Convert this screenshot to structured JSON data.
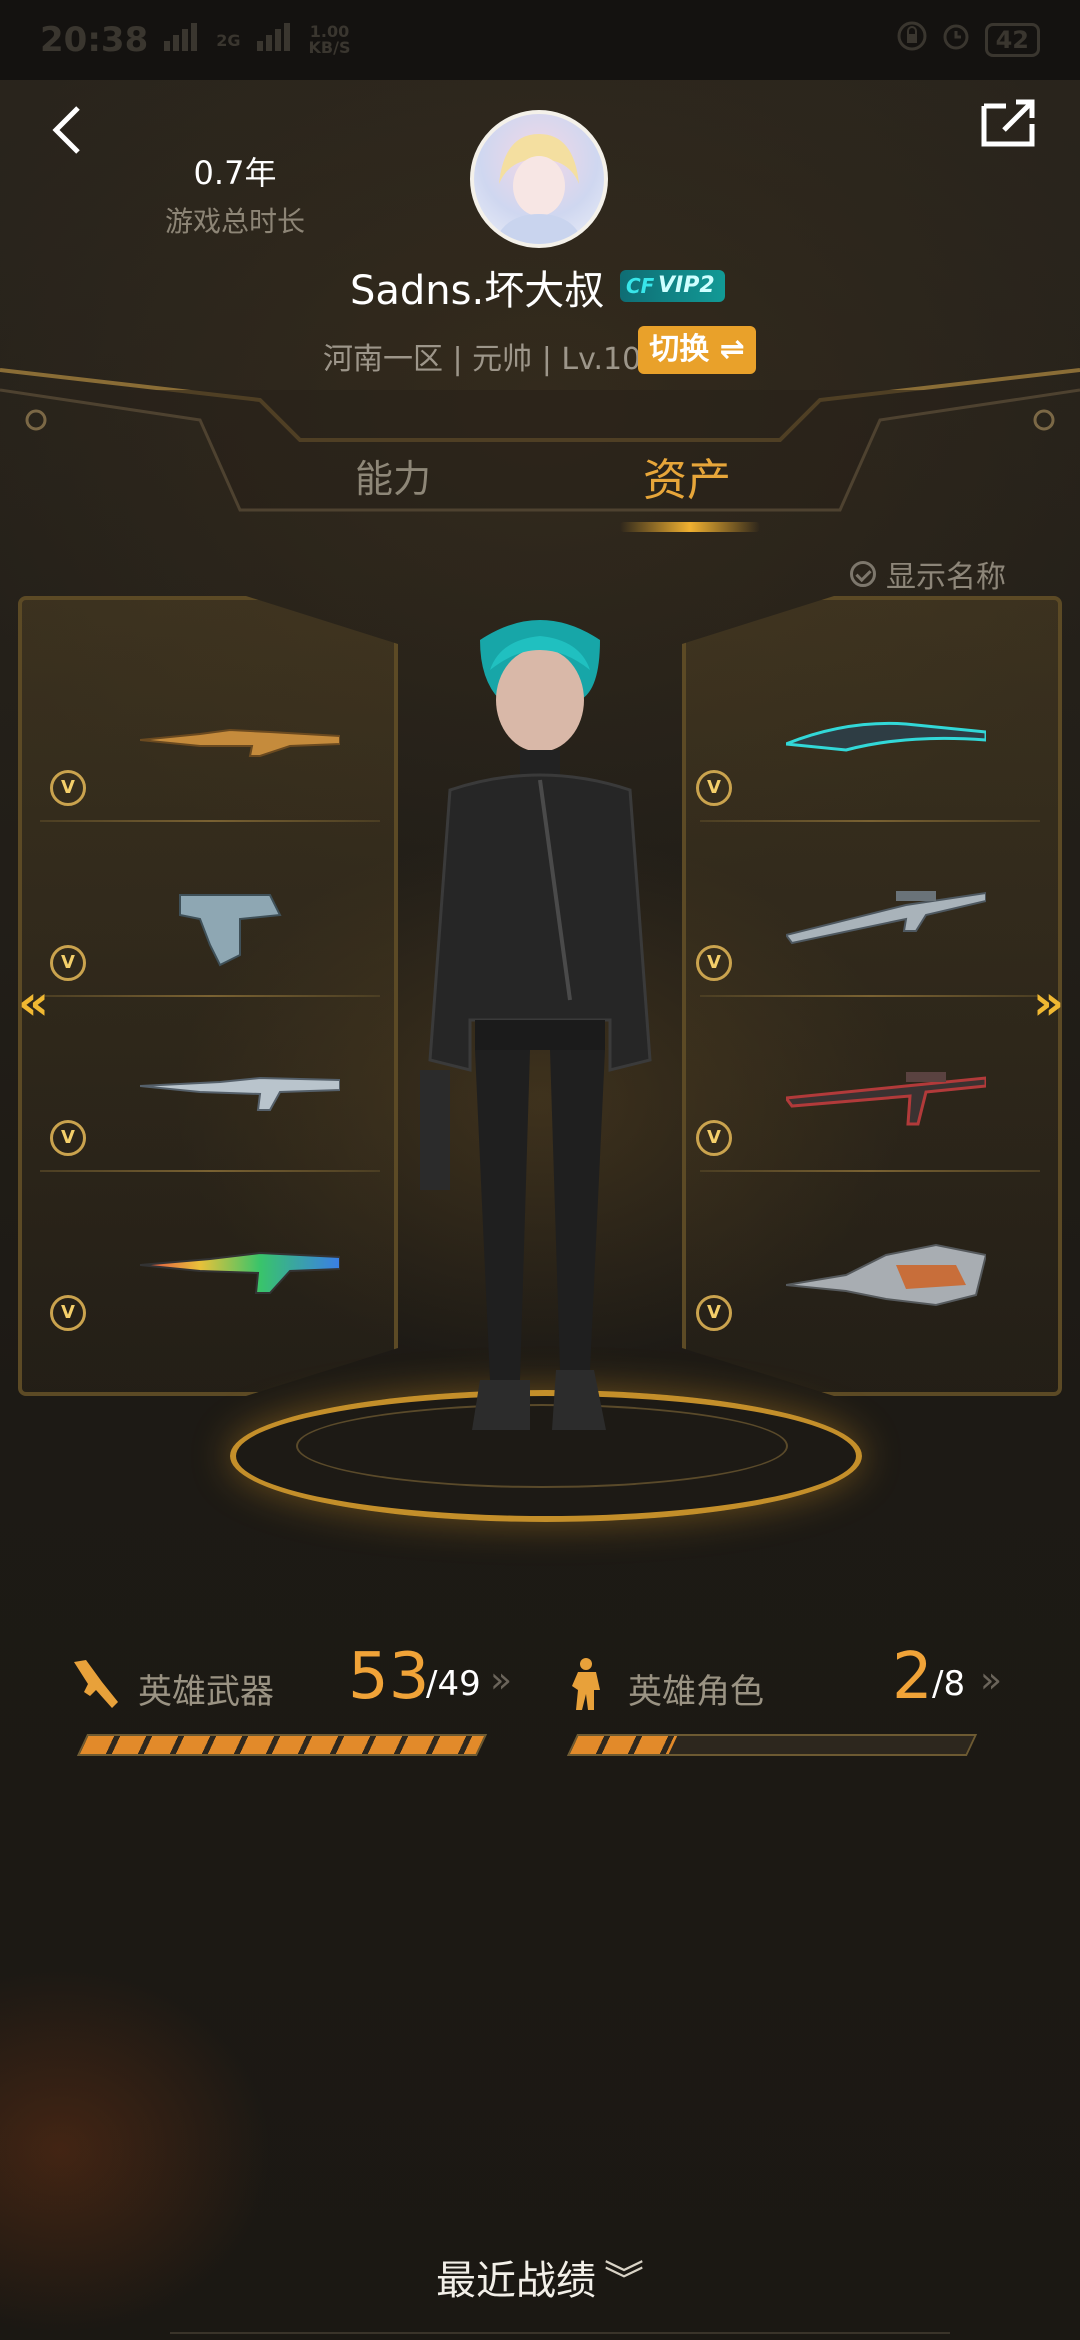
{
  "status_bar": {
    "time": "20:38",
    "network": "2G",
    "netspeed_value": "1.00",
    "netspeed_unit": "KB/S",
    "battery": "42"
  },
  "profile": {
    "game_time_value": "0.7年",
    "game_time_label": "游戏总时长",
    "username": "Sadns.坏大叔",
    "vip": "VIP2",
    "server_info": "河南一区 | 元帅 | Lv.100",
    "switch_label": "切换 ⇌"
  },
  "tabs": [
    {
      "label": "能力",
      "active": false
    },
    {
      "label": "资产",
      "active": true
    }
  ],
  "show_name_label": "显示名称",
  "weapons_left": [
    {
      "name": "rifle-ak-gold"
    },
    {
      "name": "pistol-cyan"
    },
    {
      "name": "rifle-m4-silver"
    },
    {
      "name": "rifle-m4-rainbow"
    }
  ],
  "weapons_right": [
    {
      "name": "melee-blade-cyan"
    },
    {
      "name": "sniper-silver"
    },
    {
      "name": "sniper-red"
    },
    {
      "name": "heavy-dragon"
    }
  ],
  "stats": {
    "weapons": {
      "label": "英雄武器",
      "count": "53",
      "total": "/49",
      "progress": 1.0
    },
    "roles": {
      "label": "英雄角色",
      "count": "2",
      "total": "/8",
      "progress": 0.25
    }
  },
  "recent_label": "最近战绩",
  "colors": {
    "accent": "#f0a338",
    "background": "#1e1a14"
  }
}
